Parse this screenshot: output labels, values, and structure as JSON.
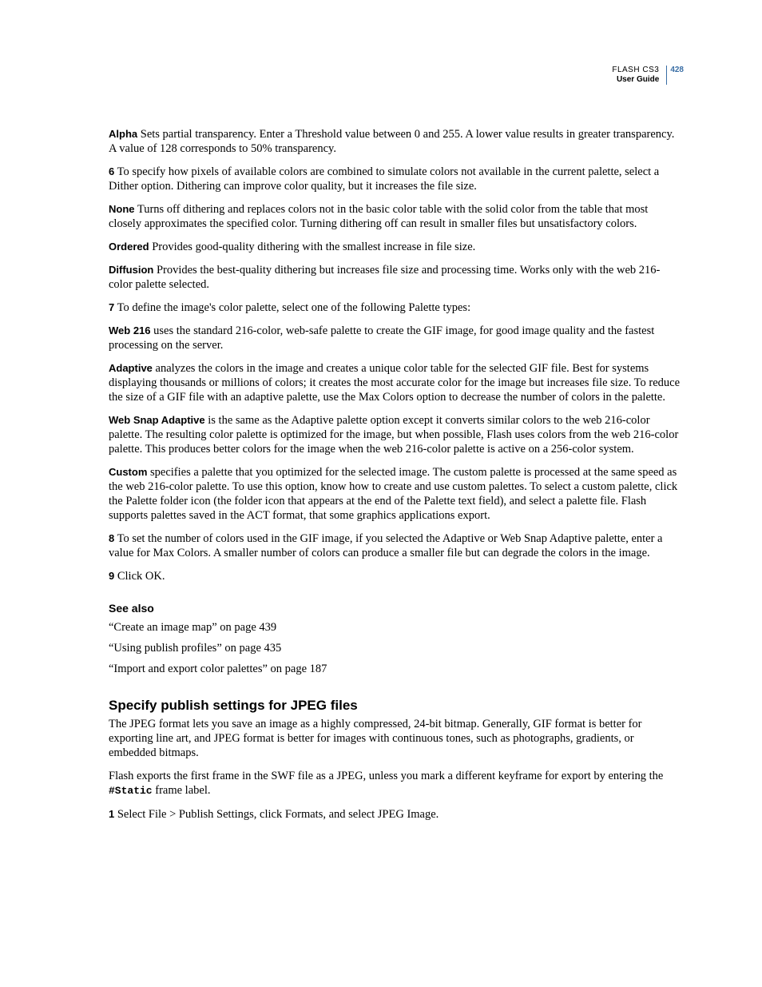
{
  "header": {
    "product": "FLASH CS3",
    "guide": "User Guide",
    "page_number": "428"
  },
  "paragraphs": {
    "alpha_term": "Alpha",
    "alpha_text": " Sets partial transparency. Enter a Threshold value between 0 and 255. A lower value results in greater transparency. A value of 128 corresponds to 50% transparency.",
    "step6_num": "6",
    "step6_text": " To specify how pixels of available colors are combined to simulate colors not available in the current palette, select a Dither option. Dithering can improve color quality, but it increases the file size.",
    "none_term": "None",
    "none_text": " Turns off dithering and replaces colors not in the basic color table with the solid color from the table that most closely approximates the specified color. Turning dithering off can result in smaller files but unsatisfactory colors.",
    "ordered_term": "Ordered",
    "ordered_text": " Provides good-quality dithering with the smallest increase in file size.",
    "diffusion_term": "Diffusion",
    "diffusion_text": " Provides the best-quality dithering but increases file size and processing time. Works only with the web 216-color palette selected.",
    "step7_num": "7",
    "step7_text": " To define the image's color palette, select one of the following Palette types:",
    "web216_term": "Web 216",
    "web216_text": " uses the standard 216-color, web-safe palette to create the GIF image, for good image quality and the fastest processing on the server.",
    "adaptive_term": "Adaptive",
    "adaptive_text": " analyzes the colors in the image and creates a unique color table for the selected GIF file. Best for systems displaying thousands or millions of colors; it creates the most accurate color for the image but increases file size. To reduce the size of a GIF file with an adaptive palette, use the Max Colors option to decrease the number of colors in the palette.",
    "websnap_term": "Web Snap Adaptive",
    "websnap_text": " is the same as the Adaptive palette option except it converts similar colors to the web 216-color palette. The resulting color palette is optimized for the image, but when possible, Flash uses colors from the web 216-color palette. This produces better colors for the image when the web 216-color palette is active on a 256-color system.",
    "custom_term": "Custom",
    "custom_text": " specifies a palette that you optimized for the selected image. The custom palette is processed at the same speed as the web 216-color palette. To use this option, know how to create and use custom palettes. To select a custom palette, click the Palette folder icon (the folder icon that appears at the end of the Palette text field), and select a palette file. Flash supports palettes saved in the ACT format, that some graphics applications export.",
    "step8_num": "8",
    "step8_text": " To set the number of colors used in the GIF image, if you selected the Adaptive or Web Snap Adaptive palette, enter a value for Max Colors. A smaller number of colors can produce a smaller file but can degrade the colors in the image.",
    "step9_num": "9",
    "step9_text": " Click OK."
  },
  "see_also": {
    "heading": "See also",
    "items": [
      "“Create an image map” on page 439",
      "“Using publish profiles” on page 435",
      "“Import and export color palettes” on page 187"
    ]
  },
  "jpeg_section": {
    "heading": "Specify publish settings for JPEG files",
    "intro": "The JPEG format lets you save an image as a highly compressed, 24-bit bitmap. Generally, GIF format is better for exporting line art, and JPEG format is better for images with continuous tones, such as photographs, gradients, or embedded bitmaps.",
    "export_pre": "Flash exports the first frame in the SWF file as a JPEG, unless you mark a different keyframe for export by entering the ",
    "code": "#Static",
    "export_post": " frame label.",
    "step1_num": "1",
    "step1_text": " Select File > Publish Settings, click Formats, and select JPEG Image."
  }
}
